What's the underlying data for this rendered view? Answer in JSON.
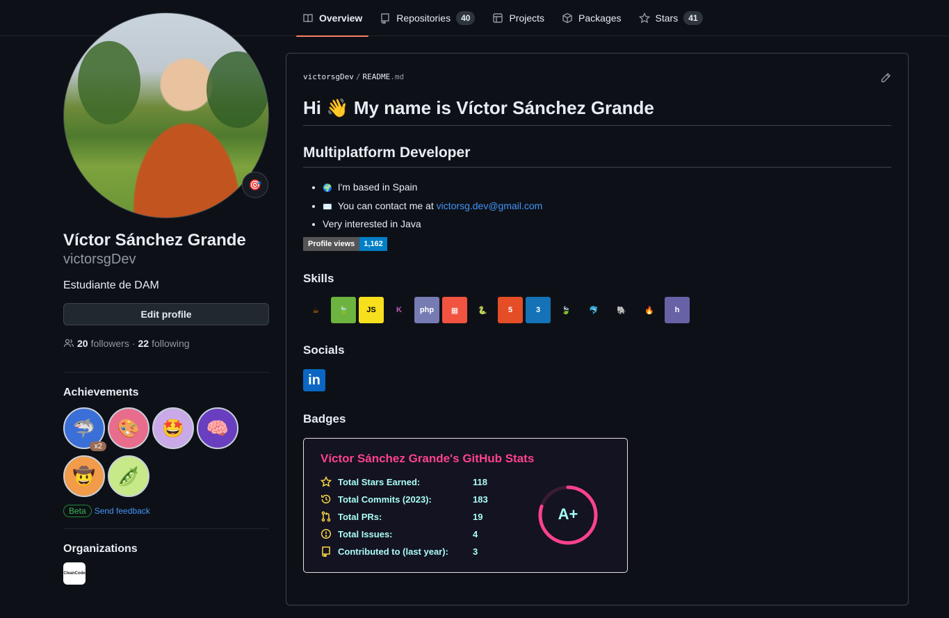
{
  "nav": {
    "tabs": [
      {
        "label": "Overview",
        "icon": "book-icon",
        "count": null
      },
      {
        "label": "Repositories",
        "icon": "repo-icon",
        "count": "40"
      },
      {
        "label": "Projects",
        "icon": "table-icon",
        "count": null
      },
      {
        "label": "Packages",
        "icon": "package-icon",
        "count": null
      },
      {
        "label": "Stars",
        "icon": "star-icon",
        "count": "41"
      }
    ]
  },
  "profile": {
    "full_name": "Víctor Sánchez Grande",
    "username": "victorsgDev",
    "bio": "Estudiante de DAM",
    "status_emoji": "🎯",
    "edit_label": "Edit profile",
    "followers_count": "20",
    "followers_label": "followers",
    "separator": "·",
    "following_count": "22",
    "following_label": "following"
  },
  "achievements": {
    "title": "Achievements",
    "items": [
      {
        "name": "pull-shark",
        "emoji": "🦈",
        "multiplier": "x2",
        "bg": "#3a6fd8"
      },
      {
        "name": "yolo",
        "emoji": "🎨",
        "multiplier": null,
        "bg": "#e86d8c"
      },
      {
        "name": "starstruck",
        "emoji": "🤩",
        "multiplier": null,
        "bg": "#c9a9e8"
      },
      {
        "name": "galaxy-brain",
        "emoji": "🧠",
        "multiplier": null,
        "bg": "#6a3fbf"
      },
      {
        "name": "quickdraw",
        "emoji": "🤠",
        "multiplier": null,
        "bg": "#f29b4a"
      },
      {
        "name": "pair-extraordinaire",
        "emoji": "🫛",
        "multiplier": null,
        "bg": "#c7e98a"
      }
    ],
    "beta_label": "Beta",
    "feedback_label": "Send feedback"
  },
  "organizations": {
    "title": "Organizations",
    "org_label": "CleanCode"
  },
  "readme": {
    "owner": "victorsgDev",
    "sep": "/",
    "file_base": "README",
    "file_ext": ".md",
    "heading": "Hi 👋 My name is Víctor Sánchez Grande",
    "subheading": "Multiplatform Developer",
    "list": [
      {
        "icon": "🌍",
        "text": "I'm based in Spain",
        "link": null
      },
      {
        "icon": "✉️",
        "text": "You can contact me at ",
        "link": "victorsg.dev@gmail.com"
      },
      {
        "icon": null,
        "text": "Very interested in Java",
        "link": null
      }
    ],
    "views_label": "Profile views",
    "views_count": "1,162",
    "skills_title": "Skills",
    "skills": [
      {
        "name": "java",
        "glyph": "☕",
        "bg": "transparent",
        "fg": "#e76f00"
      },
      {
        "name": "spring",
        "glyph": "🍃",
        "bg": "#6db33f",
        "fg": "#fff"
      },
      {
        "name": "javascript",
        "glyph": "JS",
        "bg": "#f7df1e",
        "fg": "#000"
      },
      {
        "name": "kotlin",
        "glyph": "K",
        "bg": "transparent",
        "fg": "#c757bc"
      },
      {
        "name": "php",
        "glyph": "php",
        "bg": "#777bb3",
        "fg": "#fff"
      },
      {
        "name": "laravel",
        "glyph": "▦",
        "bg": "#f05340",
        "fg": "#fff"
      },
      {
        "name": "python",
        "glyph": "🐍",
        "bg": "transparent",
        "fg": "#ffd343"
      },
      {
        "name": "html5",
        "glyph": "5",
        "bg": "#e44d26",
        "fg": "#fff"
      },
      {
        "name": "css3",
        "glyph": "3",
        "bg": "#1572b6",
        "fg": "#fff"
      },
      {
        "name": "mongodb",
        "glyph": "🍃",
        "bg": "transparent",
        "fg": "#4faa41"
      },
      {
        "name": "mysql",
        "glyph": "🐬",
        "bg": "transparent",
        "fg": "#00758f"
      },
      {
        "name": "postgresql",
        "glyph": "🐘",
        "bg": "transparent",
        "fg": "#336791"
      },
      {
        "name": "firebase",
        "glyph": "🔥",
        "bg": "transparent",
        "fg": "#ffca28"
      },
      {
        "name": "heroku",
        "glyph": "h",
        "bg": "#6762a6",
        "fg": "#fff"
      }
    ],
    "socials_title": "Socials",
    "linkedin_glyph": "in",
    "badges_title": "Badges"
  },
  "stats_card": {
    "title": "Víctor Sánchez Grande's GitHub Stats",
    "rows": [
      {
        "label": "Total Stars Earned:",
        "value": "118",
        "icon": "star-icon"
      },
      {
        "label": "Total Commits (2023):",
        "value": "183",
        "icon": "history-icon"
      },
      {
        "label": "Total PRs:",
        "value": "19",
        "icon": "pr-icon"
      },
      {
        "label": "Total Issues:",
        "value": "4",
        "icon": "issue-icon"
      },
      {
        "label": "Contributed to (last year):",
        "value": "3",
        "icon": "repo-icon"
      }
    ],
    "grade": "A+",
    "grade_progress": 0.8,
    "colors": {
      "title": "#fe428e",
      "text": "#a9fef7",
      "icon": "#f8d847",
      "bg": "#141321",
      "ring": "#fe428e"
    }
  }
}
